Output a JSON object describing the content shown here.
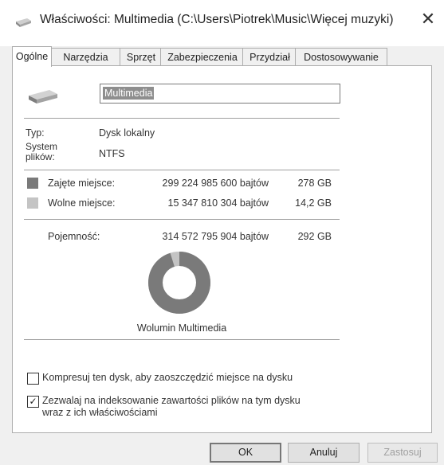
{
  "window": {
    "title": "Właściwości: Multimedia (C:\\Users\\Piotrek\\Music\\Więcej muzyki)",
    "close_glyph": "✕"
  },
  "tabs": [
    "Ogólne",
    "Narzędzia",
    "Sprzęt",
    "Zabezpieczenia",
    "Przydział",
    "Dostosowywanie"
  ],
  "general": {
    "name_value": "Multimedia",
    "type_label": "Typ:",
    "type_value": "Dysk lokalny",
    "fs_label_line1": "System",
    "fs_label_line2": "plików:",
    "fs_value": "NTFS",
    "used": {
      "label": "Zajęte miejsce:",
      "bytes": "299 224 985 600 bajtów",
      "size": "278 GB",
      "color": "#7a7a7a"
    },
    "free": {
      "label": "Wolne miejsce:",
      "bytes": "15 347 810 304 bajtów",
      "size": "14,2 GB",
      "color": "#c4c4c4"
    },
    "capacity": {
      "label": "Pojemność:",
      "bytes": "314 572 795 904 bajtów",
      "size": "292 GB"
    },
    "volume_label": "Wolumin Multimedia",
    "usage_fraction_used": 0.951
  },
  "options": {
    "compress": {
      "label": "Kompresuj ten dysk, aby zaoszczędzić miejsce na dysku",
      "checked": false
    },
    "index": {
      "label_line1": "Zezwalaj na indeksowanie zawartości plików na tym dysku",
      "label_line2": "wraz z ich właściwościami",
      "checked": true,
      "glyph": "✓"
    }
  },
  "buttons": {
    "ok": "OK",
    "cancel": "Anuluj",
    "apply": "Zastosuj"
  },
  "icons": {
    "window": "drive-icon",
    "drive": "drive-icon"
  }
}
